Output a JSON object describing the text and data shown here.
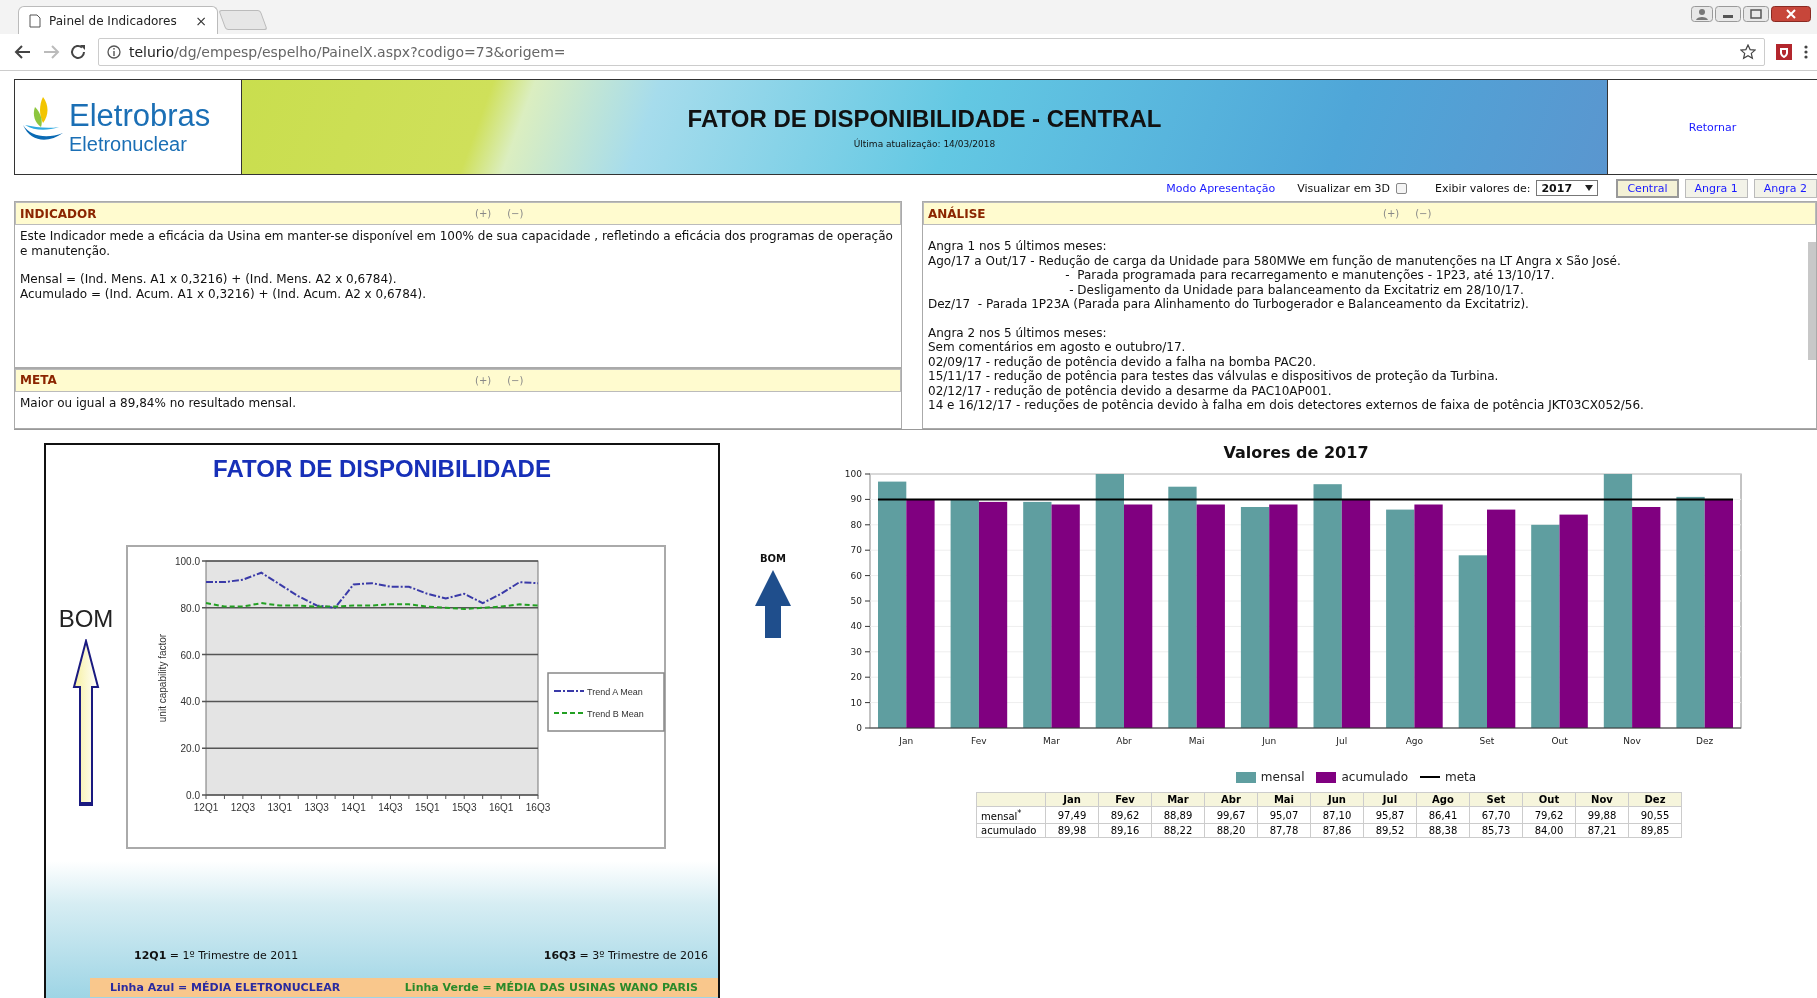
{
  "browser": {
    "tab_title": "Painel de Indicadores",
    "tab_close": "×",
    "url_host": "telurio",
    "url_path": "/dg/empesp/espelho/PainelX.aspx?codigo=73&origem="
  },
  "header": {
    "logo_name": "Eletrobras",
    "logo_sub": "Eletronuclear",
    "title": "FATOR DE DISPONIBILIDADE - CENTRAL",
    "updated": "Última atualização:  14/03/2018",
    "back_link": "Retornar"
  },
  "toolbar": {
    "presentation_link": "Modo Apresentação",
    "view_3d_label": "Visualizar em 3D",
    "view_3d_checked": false,
    "show_values_label": "Exibir valores de:",
    "year": "2017",
    "units": [
      {
        "label": "Central",
        "selected": true
      },
      {
        "label": "Angra 1",
        "selected": false
      },
      {
        "label": "Angra 2",
        "selected": false
      }
    ]
  },
  "left_panels": [
    {
      "title": "INDICADOR",
      "expand": "(+)",
      "collapse": "(−)",
      "paragraphs": [
        "Este Indicador mede a eficácia da Usina em manter-se disponível em 100% de sua capacidade , refletindo a eficácia dos programas de operação e manutenção.",
        "Mensal = (Ind. Mens. A1 x 0,3216) + (Ind. Mens. A2 x 0,6784).\nAcumulado = (Ind. Acum. A1 x 0,3216) + (Ind. Acum. A2 x 0,6784)."
      ]
    },
    {
      "title": "META",
      "expand": "(+)",
      "collapse": "(−)",
      "paragraphs": [
        "Maior ou igual a 89,84% no resultado mensal."
      ]
    }
  ],
  "right_panels": [
    {
      "title": "ANÁLISE",
      "expand": "(+)",
      "collapse": "(−)",
      "paragraphs": [
        "Angra 1 nos 5 últimos meses:\nAgo/17 a Out/17 - Redução de carga da Unidade para 580MWe em função de manutenções na LT Angra x São José.\n                                    -  Parada programada para recarregamento e manutenções - 1P23, até 13/10/17.\n                                     - Desligamento da Unidade para balanceamento da Excitatriz em 28/10/17.\nDez/17  - Parada 1P23A (Parada para Alinhamento do Turbogerador e Balanceamento da Excitatriz).",
        "Angra 2 nos 5 últimos meses:\nSem comentários em agosto e outubro/17.\n02/09/17 - redução de potência devido a falha na bomba PAC20.\n15/11/17 - redução de potência para testes das válvulas e dispositivos de proteção da Turbina.\n02/12/17 - redução de potência devido a desarme da PAC10AP001.\n14 e 16/12/17 - reduções de potência devido à falha em dois detectores externos de faixa de potência JKT03CX052/56."
      ]
    }
  ],
  "slide": {
    "title": "FATOR DE DISPONIBILIDADE",
    "bom": "BOM",
    "chart_data": {
      "type": "line",
      "ylabel": "unit capability factor",
      "grid": true,
      "legend": true,
      "categories": [
        "12Q1",
        null,
        "12Q3",
        null,
        "13Q1",
        null,
        "13Q3",
        null,
        "14Q1",
        null,
        "14Q3",
        null,
        "15Q1",
        null,
        "15Q3",
        null,
        "16Q1",
        null,
        "16Q3"
      ],
      "ylim": [
        0,
        100
      ],
      "yticks": [
        {
          "value": 0,
          "label": "0.0"
        },
        {
          "value": 20,
          "label": "20.0"
        },
        {
          "value": 40,
          "label": "40.0"
        },
        {
          "value": 60,
          "label": "60.0"
        },
        {
          "value": 80,
          "label": "80.0"
        },
        {
          "value": 100,
          "label": "100.0"
        }
      ],
      "series": [
        {
          "name": "Trend A Mean",
          "color": "#3a3aa8",
          "line_style": "dashdot",
          "values": [
            91,
            91,
            92,
            95,
            90,
            85,
            81,
            80,
            90,
            90.5,
            89,
            89,
            86,
            84,
            86,
            82,
            86,
            91,
            90.5
          ]
        },
        {
          "name": "Trend B Mean",
          "color": "#22a022",
          "line_style": "dashed",
          "values": [
            82,
            80.5,
            80.5,
            82,
            81,
            81,
            80.5,
            80.5,
            81,
            81,
            81.5,
            81.5,
            80.5,
            80,
            79.5,
            80,
            80.5,
            81.5,
            81
          ]
        }
      ]
    },
    "note_left": "**12Q1** = 1º Trimestre de 2011",
    "note_right": "**16Q3** = 3º Trimestre de 2016",
    "band_left": "Linha Azul = MÉDIA ELETRONUCLEAR",
    "band_right": "Linha Verde = MÉDIA DAS USINAS WANO PARIS"
  },
  "results": {
    "bom": "BOM",
    "chart_data": {
      "type": "bar",
      "title": "Valores de 2017",
      "stacked": false,
      "categories": [
        "Jan",
        "Fev",
        "Mar",
        "Abr",
        "Mai",
        "Jun",
        "Jul",
        "Ago",
        "Set",
        "Out",
        "Nov",
        "Dez"
      ],
      "ylim": [
        0,
        100
      ],
      "yticks": [
        0,
        10,
        20,
        30,
        40,
        50,
        60,
        70,
        80,
        90,
        100
      ],
      "series": [
        {
          "name": "mensal",
          "color": "#5f9ea0",
          "values": [
            97,
            90,
            89,
            100,
            95,
            87,
            96,
            86,
            68,
            80,
            100,
            91
          ]
        },
        {
          "name": "acumulado",
          "color": "#800080",
          "values": [
            90,
            89,
            88,
            88,
            88,
            88,
            90,
            88,
            86,
            84,
            87,
            90
          ]
        }
      ],
      "ref_lines": [
        {
          "axis": "y",
          "value": 90,
          "label": "meta",
          "color": "#000000"
        }
      ],
      "grid": true,
      "legend": true
    },
    "table": {
      "columns": [
        "Jan",
        "Fev",
        "Mar",
        "Abr",
        "Mai",
        "Jun",
        "Jul",
        "Ago",
        "Set",
        "Out",
        "Nov",
        "Dez"
      ],
      "rows": [
        {
          "label": "mensal$^{*}$",
          "cells": [
            "97,49",
            "89,62",
            "88,89",
            "99,67",
            "95,07",
            "87,10",
            "95,87",
            "86,41",
            "67,70",
            "79,62",
            "99,88",
            "90,55"
          ]
        },
        {
          "label": "acumulado",
          "cells": [
            "89,98",
            "89,16",
            "88,22",
            "88,20",
            "87,78",
            "87,86",
            "89,52",
            "88,38",
            "85,73",
            "84,00",
            "87,21",
            "89,85"
          ]
        }
      ]
    }
  }
}
